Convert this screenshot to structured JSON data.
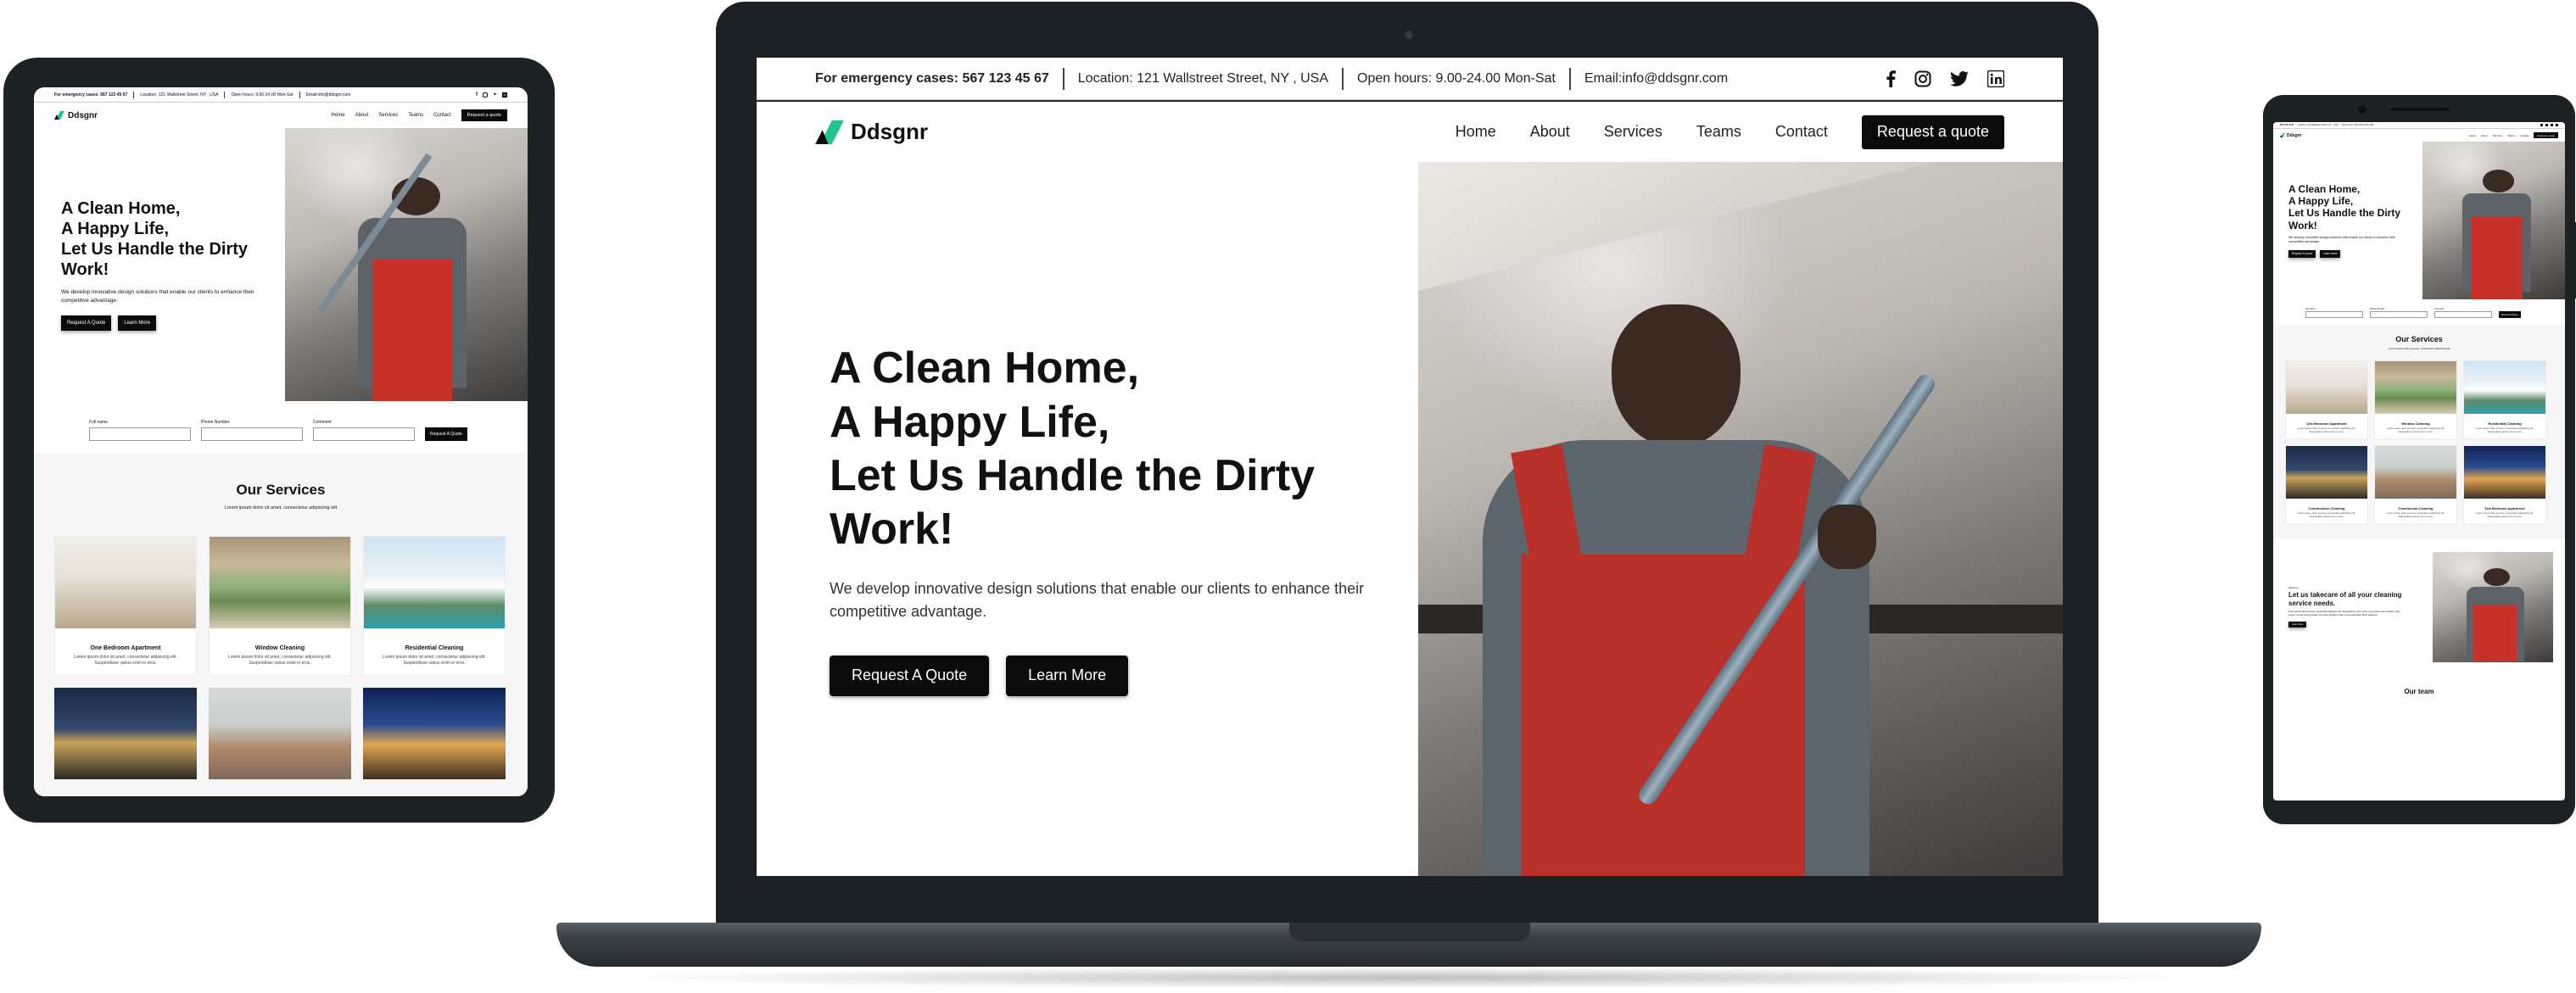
{
  "site": {
    "brand": "Ddsgnr",
    "topbar": {
      "emergency_label": "For emergency cases:",
      "emergency_phone": "567 123 45 67",
      "location": "Location: 121 Wallstreet Street, NY , USA",
      "hours": "Open hours: 9.00-24.00 Mon-Sat",
      "email": "Email:info@ddsgnr.com",
      "social_icons": [
        "facebook-icon",
        "instagram-icon",
        "twitter-icon",
        "linkedin-icon"
      ]
    },
    "nav": {
      "items": [
        "Home",
        "About",
        "Services",
        "Teams",
        "Contact"
      ],
      "cta": "Request a quote"
    },
    "hero": {
      "title_lines": [
        "A Clean Home,",
        "A Happy Life,",
        "Let Us Handle the Dirty",
        "Work!"
      ],
      "subtitle": "We develop innovative design solutions that enable our clients to enhance their competitive advantage.",
      "primary_button": "Request A Quote",
      "secondary_button": "Learn More"
    },
    "quote_form": {
      "name_label": "Full name",
      "phone_label": "Phone Number",
      "comment_label": "Comment",
      "submit": "Request A Quote"
    },
    "services": {
      "title": "Our Services",
      "subtitle": "Lorem ipsum dolor sit amet, consectetur adipiscing elit",
      "items": [
        {
          "name": "One Bedroom Apartment",
          "desc": "Lorem ipsum dolor sit amet, consectetur adipiscing elit. Suspendisse varius enim in eros.",
          "image": "bedroom"
        },
        {
          "name": "Window Cleaning",
          "desc": "Lorem ipsum dolor sit amet, consectetur adipiscing elit. Suspendisse varius enim in eros.",
          "image": "window"
        },
        {
          "name": "Residential Cleaning",
          "desc": "Lorem ipsum dolor sit amet, consectetur adipiscing elit. Suspendisse varius enim in eros.",
          "image": "house"
        },
        {
          "name": "Construction Cleaning",
          "desc": "Lorem ipsum dolor sit amet, consectetur adipiscing elit. Suspendisse varius enim in eros.",
          "image": "dusk-house"
        },
        {
          "name": "Commercial Cleaning",
          "desc": "Lorem ipsum dolor sit amet, consectetur adipiscing elit. Suspendisse varius enim in eros.",
          "image": "living-room"
        },
        {
          "name": "Two Bedroom Apartment",
          "desc": "Lorem ipsum dolor sit amet, consectetur adipiscing elit. Suspendisse varius enim in eros.",
          "image": "night-house"
        }
      ]
    },
    "about": {
      "eyebrow": "About us",
      "title": "Let us takecare of all your cleaning service needs.",
      "body": "Lorem ipsum dolor sit amet, consectetur adipiscing elit. Suspendisse varius enim in eros elementum tristique. Duis cursus, mi quis viverra ornare, eros dolor interdum nulla, ut commodo diam libero vitae erat.",
      "button": "Learn More"
    },
    "team": {
      "title": "Our team"
    }
  },
  "colors": {
    "accent_green": "#22c58b",
    "black": "#0b0b0b",
    "device_frame": "#1d2225"
  }
}
